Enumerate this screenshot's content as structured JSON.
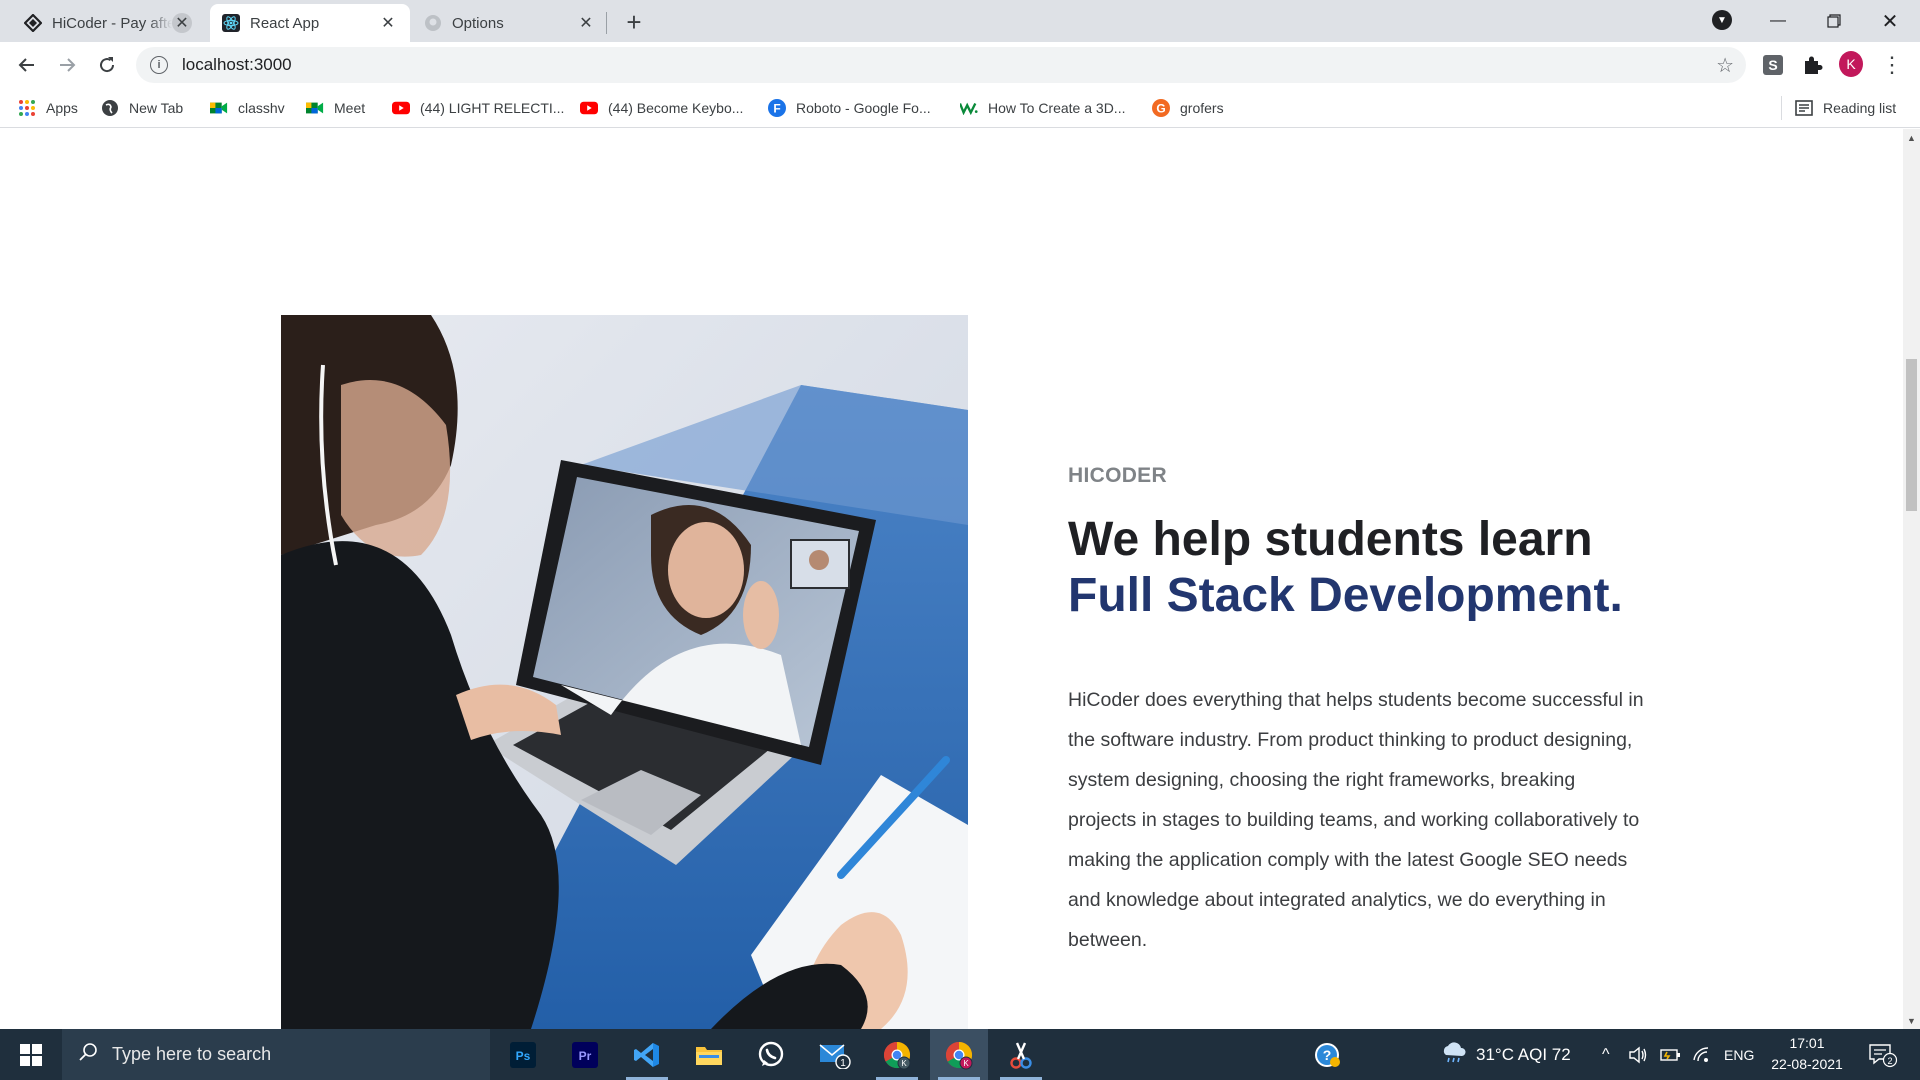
{
  "browser": {
    "tabs": [
      {
        "title": "HiCoder - Pay after",
        "active": false
      },
      {
        "title": "React App",
        "active": true
      },
      {
        "title": "Options",
        "active": false
      }
    ],
    "address": "localhost:3000",
    "profile_initial": "K",
    "bookmarks": [
      {
        "label": "Apps",
        "icon": "apps-grid-icon"
      },
      {
        "label": "New Tab",
        "icon": "globe-icon"
      },
      {
        "label": "classhv",
        "icon": "google-meet-icon"
      },
      {
        "label": "Meet",
        "icon": "google-meet-icon"
      },
      {
        "label": "(44) LIGHT RELECTI...",
        "icon": "youtube-icon"
      },
      {
        "label": "(44) Become Keybo...",
        "icon": "youtube-icon"
      },
      {
        "label": "Roboto - Google Fo...",
        "icon": "google-fonts-icon"
      },
      {
        "label": "How To Create a 3D...",
        "icon": "webflow-icon"
      },
      {
        "label": "grofers",
        "icon": "grofers-icon"
      }
    ],
    "reading_list": "Reading list"
  },
  "page": {
    "eyebrow": "HICODER",
    "headline_line1": "We help students learn",
    "headline_line2": "Full Stack Development.",
    "body": "HiCoder does everything that helps students become successful in the software industry. From product thinking to product designing, system designing, choosing the right frameworks, breaking projects in stages to building teams, and working collaboratively to making the application comply with the latest Google SEO needs and knowledge about integrated analytics, we do everything in between."
  },
  "taskbar": {
    "search_placeholder": "Type here to search",
    "apps": [
      "photoshop-icon",
      "premiere-icon",
      "vscode-icon",
      "file-explorer-icon",
      "whatsapp-icon",
      "mail-icon",
      "chrome-icon",
      "chrome-icon",
      "snipping-tool-icon"
    ],
    "mail_badge": "1",
    "weather": "31°C  AQI 72",
    "language": "ENG",
    "time": "17:01",
    "date": "22-08-2021",
    "notification_count": "2"
  },
  "colors": {
    "accent_headline": "#22366f",
    "taskbar": "#1f2f3d"
  }
}
